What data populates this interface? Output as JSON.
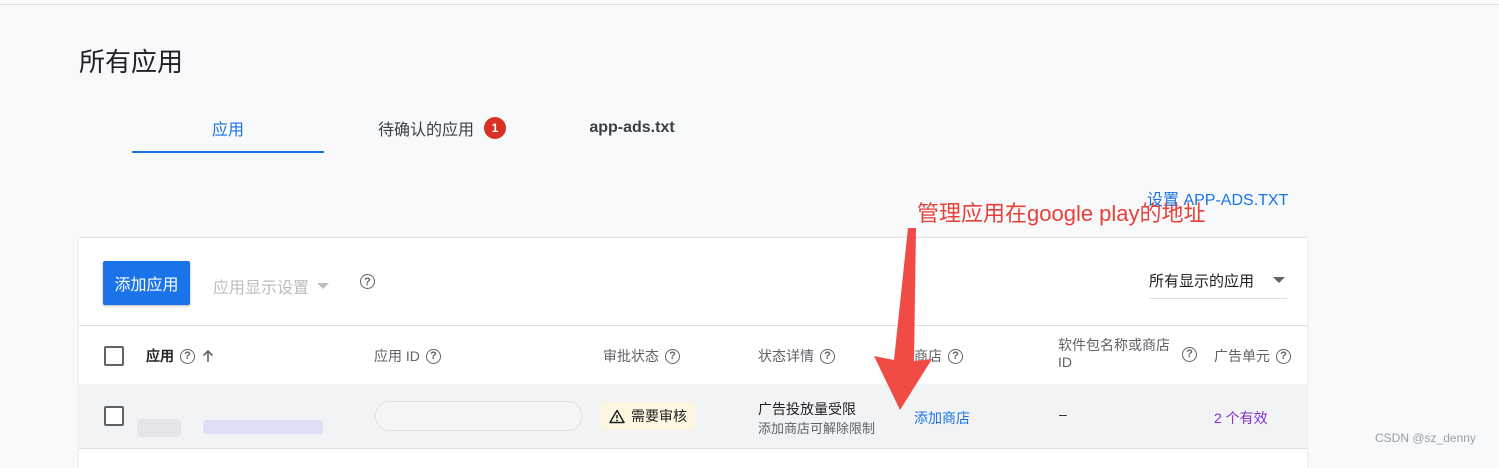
{
  "page": {
    "title": "所有应用",
    "tabs": [
      {
        "label": "应用",
        "active": true
      },
      {
        "label": "待确认的应用",
        "badge": "1"
      },
      {
        "label": "app-ads.txt"
      }
    ],
    "setup_link": "设置 APP-ADS.TXT",
    "annotation": "管理应用在google play的地址"
  },
  "toolbar": {
    "add_app": "添加应用",
    "display_settings": "应用显示设置",
    "filter": "所有显示的应用"
  },
  "table": {
    "headers": [
      "应用",
      "应用 ID",
      "审批状态",
      "状态详情",
      "商店",
      "软件包名称或商店 ID",
      "广告单元"
    ],
    "row": {
      "approval": "需要审核",
      "status_line1": "广告投放量受限",
      "status_line2": "添加商店可解除限制",
      "store": "添加商店",
      "package": "–",
      "ad_units": "2 个有效"
    }
  },
  "watermark": "CSDN @sz_denny",
  "colors": {
    "accent": "#1a73e8",
    "badge": "#d93025",
    "annotation": "#e8413a",
    "warning_chip": "#fef7e0",
    "ad_units": "#8430ce"
  },
  "icons": [
    "help-icon",
    "sort-arrow-up-icon",
    "caret-down-icon",
    "warning-icon",
    "checkbox-icon",
    "red-arrow-icon"
  ]
}
